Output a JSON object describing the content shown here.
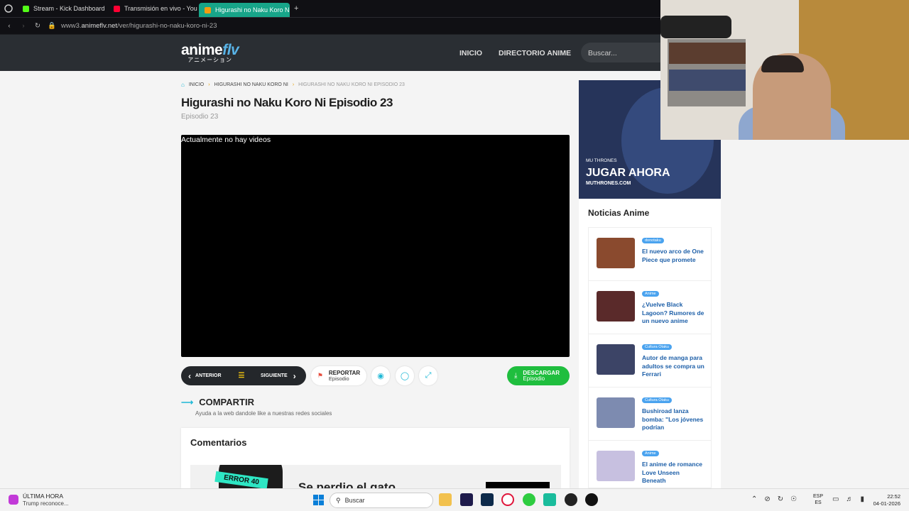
{
  "browser": {
    "tabs": [
      {
        "label": "Stream - Kick Dashboard",
        "color": "#53fc18"
      },
      {
        "label": "Transmisión en vivo - You",
        "color": "#ff0033"
      },
      {
        "label": "Higurashi no Naku Koro Ni",
        "color": "#f39c12"
      }
    ],
    "new_tab": "+",
    "url_prefix": "www3.",
    "url_host": "animeflv.net",
    "url_path": "/ver/higurashi-no-naku-koro-ni-23"
  },
  "site": {
    "logo_main": "anime",
    "logo_accent": "flv",
    "logo_sub": "アニメーション",
    "nav": [
      "INICIO",
      "DIRECTORIO ANIME"
    ],
    "search_placeholder": "Buscar..."
  },
  "breadcrumb": [
    "INICIO",
    "HIGURASHI NO NAKU KORO NI",
    "HIGURASHI NO NAKU KORO NI EPISODIO 23"
  ],
  "episode": {
    "title": "Higurashi no Naku Koro Ni Episodio 23",
    "subtitle": "Episodio 23",
    "player_message": "Actualmente no hay videos"
  },
  "controls": {
    "prev": "ANTERIOR",
    "next": "SIGUIENTE",
    "report_title": "REPORTAR",
    "report_sub": "Episodio",
    "download_title": "DESCARGAR",
    "download_sub": "Episodio"
  },
  "share": {
    "title": "COMPARTIR",
    "subtitle": "Ayuda a la web dandole like a nuestras redes sociales"
  },
  "comments": {
    "title": "Comentarios",
    "error_badge": "ERROR 40",
    "error_title": "Se perdio el gato"
  },
  "ad": {
    "brand": "MU THRONES",
    "cta": "JUGAR AHORA",
    "site": "MUTHRONES.COM"
  },
  "news": {
    "title": "Noticias Anime",
    "items": [
      {
        "tag": "donotaku",
        "title": "El nuevo arco de One Piece que promete"
      },
      {
        "tag": "Anime",
        "title": "¿Vuelve Black Lagoon? Rumores de un nuevo anime"
      },
      {
        "tag": "Cultura Otaku",
        "title": "Autor de manga para adultos se compra un Ferrari"
      },
      {
        "tag": "Cultura Otaku",
        "title": "Bushiroad lanza bomba: \"Los jóvenes podrían"
      },
      {
        "tag": "Anime",
        "title": "El anime de romance Love Unseen Beneath"
      }
    ]
  },
  "taskbar": {
    "news_title": "ÚLTIMA HORA",
    "news_sub": "Trump reconoce...",
    "search": "Buscar",
    "lang_top": "ESP",
    "lang_bottom": "ES",
    "time": "22:52",
    "date": "04-01-2026"
  }
}
